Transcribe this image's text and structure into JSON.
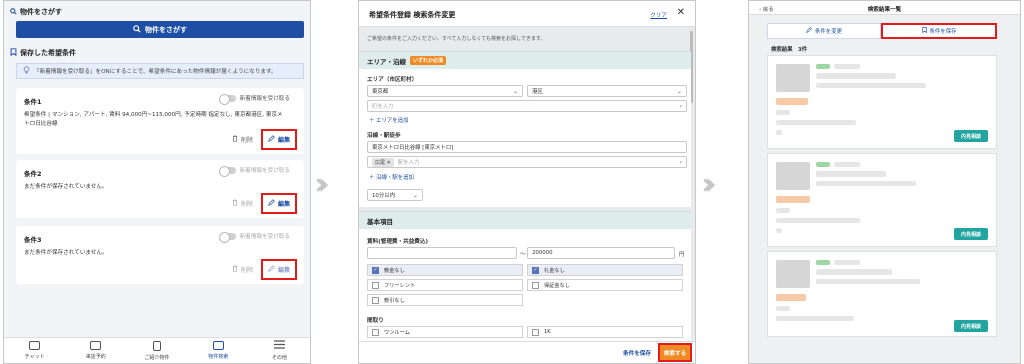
{
  "panel1": {
    "section_search": "物件をさがす",
    "search_button": "物件をさがす",
    "section_saved": "保存した希望条件",
    "note": "「新着情報を受け取る」をONにすることで、希望条件にあった物件情報が届くようになります。",
    "cards": [
      {
        "title": "条件1",
        "toggle_label": "新着情報を受け取る",
        "body": "希望条件 | マンション, アパート, 賃料 94,000円~115,000円, 予定時期 指定なし, 東京都港区, 東京メトロ日比谷線",
        "delete": "削除",
        "edit": "編集"
      },
      {
        "title": "条件2",
        "toggle_label": "新着情報を受け取る",
        "body": "まだ条件が保存されていません。",
        "delete": "削除",
        "edit": "編集"
      },
      {
        "title": "条件3",
        "toggle_label": "新着情報を受け取る",
        "body": "まだ条件が保存されていません。",
        "delete": "削除",
        "edit": "編集"
      }
    ],
    "tabs": [
      {
        "label": "チャット",
        "icon": "chat-icon"
      },
      {
        "label": "来店予約",
        "icon": "calendar-icon"
      },
      {
        "label": "ご紹介物件",
        "icon": "document-icon"
      },
      {
        "label": "物件検索",
        "icon": "search-icon"
      },
      {
        "label": "その他",
        "icon": "menu-icon"
      }
    ]
  },
  "panel2": {
    "title": "希望条件登録 検索条件変更",
    "clear": "クリア",
    "note": "ご希望の条件をご入力ください。すべて入力しなくても検索をお探しできます。",
    "area_section": "エリア・沿線",
    "required_badge": "いずれか必須",
    "area_label": "エリア（市区町村）",
    "pref_value": "東京都",
    "city_value": "港区",
    "town_placeholder": "町を入力",
    "add_area": "＋ エリアを追加",
    "line_label": "沿線・駅徒歩",
    "line_value": "東京メトロ日比谷線 [東京メトロ]",
    "station_chip": "広尾",
    "station_placeholder": "駅を入力",
    "add_line": "＋ 沿線・駅を追加",
    "walk_value": "10分以内",
    "basic_section": "基本項目",
    "rent_label": "賃料(管理費・共益費込)",
    "rent_min": "",
    "rent_max": "200000",
    "rent_unit": "円",
    "checks": [
      {
        "label": "敷金なし",
        "checked": true
      },
      {
        "label": "礼金なし",
        "checked": true
      },
      {
        "label": "フリーレント",
        "checked": false
      },
      {
        "label": "保証金なし",
        "checked": false
      },
      {
        "label": "敷引なし",
        "checked": false
      }
    ],
    "layout_label": "間取り",
    "layout_checks": [
      {
        "label": "ワンルーム",
        "checked": false
      },
      {
        "label": "1K",
        "checked": false
      }
    ],
    "save_condition": "条件を保存",
    "search_button": "検索する"
  },
  "panel3": {
    "back": "戻る",
    "title": "検索結果一覧",
    "tab_change": "条件を変更",
    "tab_save": "条件を保存",
    "result_count": "検索結果　3件",
    "detail_button": "内見相談"
  },
  "colors": {
    "primary": "#1e4fa5",
    "highlight_red": "#e21b1b",
    "orange": "#f08a23",
    "teal": "#22a4a0"
  }
}
